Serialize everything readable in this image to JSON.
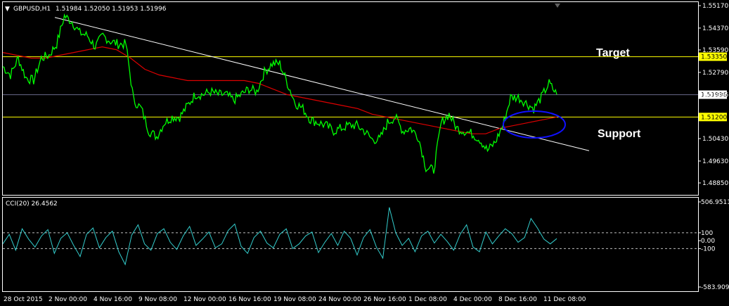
{
  "header": {
    "menu_glyph": "▼",
    "title": "GBPUSD,H1",
    "ohlc": "1.51984 1.52050 1.51953 1.51996"
  },
  "cci_header": "CCI(20) 26.4562",
  "annotations": {
    "target": "Target",
    "support": "Support"
  },
  "colors": {
    "background": "#000000",
    "price": "#00ff00",
    "moving_average": "#dd0000",
    "trendline": "#ffffff",
    "horizontal_levels": "#ffff00",
    "current_price_line": "#6a6a8a",
    "cci": "#33cccc",
    "ellipse": "#1010ff",
    "grid_frame": "#ffffff"
  },
  "chart_data": [
    {
      "type": "line",
      "title": "GBPUSD,H1",
      "ylim": [
        1.4855,
        1.5517
      ],
      "y_ticks": [
        "1.55170",
        "1.54370",
        "1.53590",
        "1.52790",
        "1.51996",
        "1.50430",
        "1.49630",
        "1.48850"
      ],
      "x_ticks": [
        "28 Oct 2015",
        "2 Nov 00:00",
        "4 Nov 16:00",
        "9 Nov 08:00",
        "12 Nov 00:00",
        "16 Nov 16:00",
        "19 Nov 08:00",
        "24 Nov 00:00",
        "26 Nov 16:00",
        "1 Dec 08:00",
        "4 Dec 00:00",
        "8 Dec 16:00",
        "11 Dec 08:00"
      ],
      "levels": [
        {
          "label": "1.53350",
          "value": 1.5335,
          "role": "target"
        },
        {
          "label": "1.51200",
          "value": 1.512,
          "role": "support"
        }
      ],
      "current_price": {
        "label": "1.51996",
        "value": 1.51996
      },
      "series": [
        {
          "values": [
            1.53,
            1.527,
            1.533,
            1.526,
            1.525,
            1.533,
            1.534,
            1.538,
            1.548,
            1.546,
            1.542,
            1.541,
            1.537,
            1.541,
            1.539,
            1.538,
            1.538,
            1.518,
            1.515,
            1.507,
            1.505,
            1.51,
            1.512,
            1.512,
            1.516,
            1.52,
            1.52,
            1.521,
            1.52,
            1.52,
            1.518,
            1.52,
            1.522,
            1.521,
            1.528,
            1.531,
            1.531,
            1.524,
            1.517,
            1.515,
            1.511,
            1.51,
            1.509,
            1.507,
            1.508,
            1.509,
            1.509,
            1.507,
            1.504,
            1.504,
            1.51,
            1.512,
            1.507,
            1.508,
            1.505,
            1.494,
            1.493,
            1.51,
            1.513,
            1.508,
            1.507,
            1.506,
            1.504,
            1.5,
            1.503,
            1.509,
            1.519,
            1.519,
            1.517,
            1.515,
            1.519,
            1.524,
            1.52
          ]
        },
        {
          "values": [
            1.535,
            1.534,
            1.533,
            1.533,
            1.534,
            1.535,
            1.536,
            1.537,
            1.536,
            1.533,
            1.529,
            1.527,
            1.526,
            1.525,
            1.525,
            1.525,
            1.525,
            1.525,
            1.524,
            1.522,
            1.52,
            1.519,
            1.518,
            1.517,
            1.516,
            1.515,
            1.513,
            1.512,
            1.511,
            1.51,
            1.509,
            1.508,
            1.507,
            1.506,
            1.506,
            1.508,
            1.509,
            1.51,
            1.511,
            1.512
          ]
        }
      ],
      "trendline": {
        "start": [
          "2 Nov",
          1.5475
        ],
        "end": [
          "11 Dec",
          1.5095
        ]
      }
    },
    {
      "type": "line",
      "title": "CCI(20) 26.4562",
      "ylim": [
        -583.9094,
        506.9511
      ],
      "y_ticks": [
        "506.9511",
        "100",
        "0.00",
        "-100",
        "-583.9094"
      ],
      "reference_lines": [
        100,
        -100
      ],
      "values": [
        -40,
        80,
        -120,
        150,
        20,
        -80,
        60,
        140,
        -160,
        30,
        100,
        -60,
        -200,
        80,
        160,
        -90,
        40,
        120,
        -140,
        -300,
        70,
        200,
        -40,
        -120,
        90,
        150,
        -20,
        -110,
        60,
        180,
        -60,
        20,
        110,
        -90,
        -40,
        130,
        210,
        -70,
        -160,
        40,
        120,
        -30,
        -90,
        80,
        150,
        -100,
        -40,
        60,
        110,
        -150,
        -20,
        90,
        -60,
        120,
        30,
        -180,
        40,
        140,
        -80,
        -220,
        420,
        100,
        -60,
        30,
        -140,
        60,
        120,
        -30,
        80,
        -10,
        -120,
        80,
        200,
        -80,
        -140,
        110,
        -40,
        60,
        150,
        90,
        -20,
        40,
        280,
        160,
        20,
        -40,
        26
      ]
    }
  ]
}
